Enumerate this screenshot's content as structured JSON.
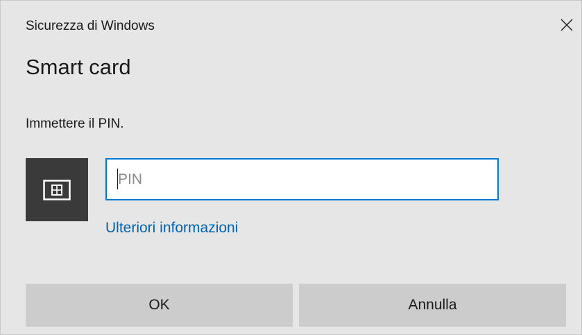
{
  "window": {
    "title": "Sicurezza di Windows",
    "close_icon": "close-icon"
  },
  "dialog": {
    "heading": "Smart card",
    "prompt": "Immettere il PIN.",
    "card_icon": "smart-card-icon",
    "pin_input": {
      "placeholder": "PIN",
      "value": ""
    },
    "more_info_link": "Ulteriori informazioni"
  },
  "buttons": {
    "ok_label": "OK",
    "cancel_label": "Annulla"
  },
  "colors": {
    "background": "#e6e6e6",
    "accent": "#0078d7",
    "link": "#0063b1",
    "card_tile": "#3a3a3a",
    "button": "#cccccc"
  }
}
